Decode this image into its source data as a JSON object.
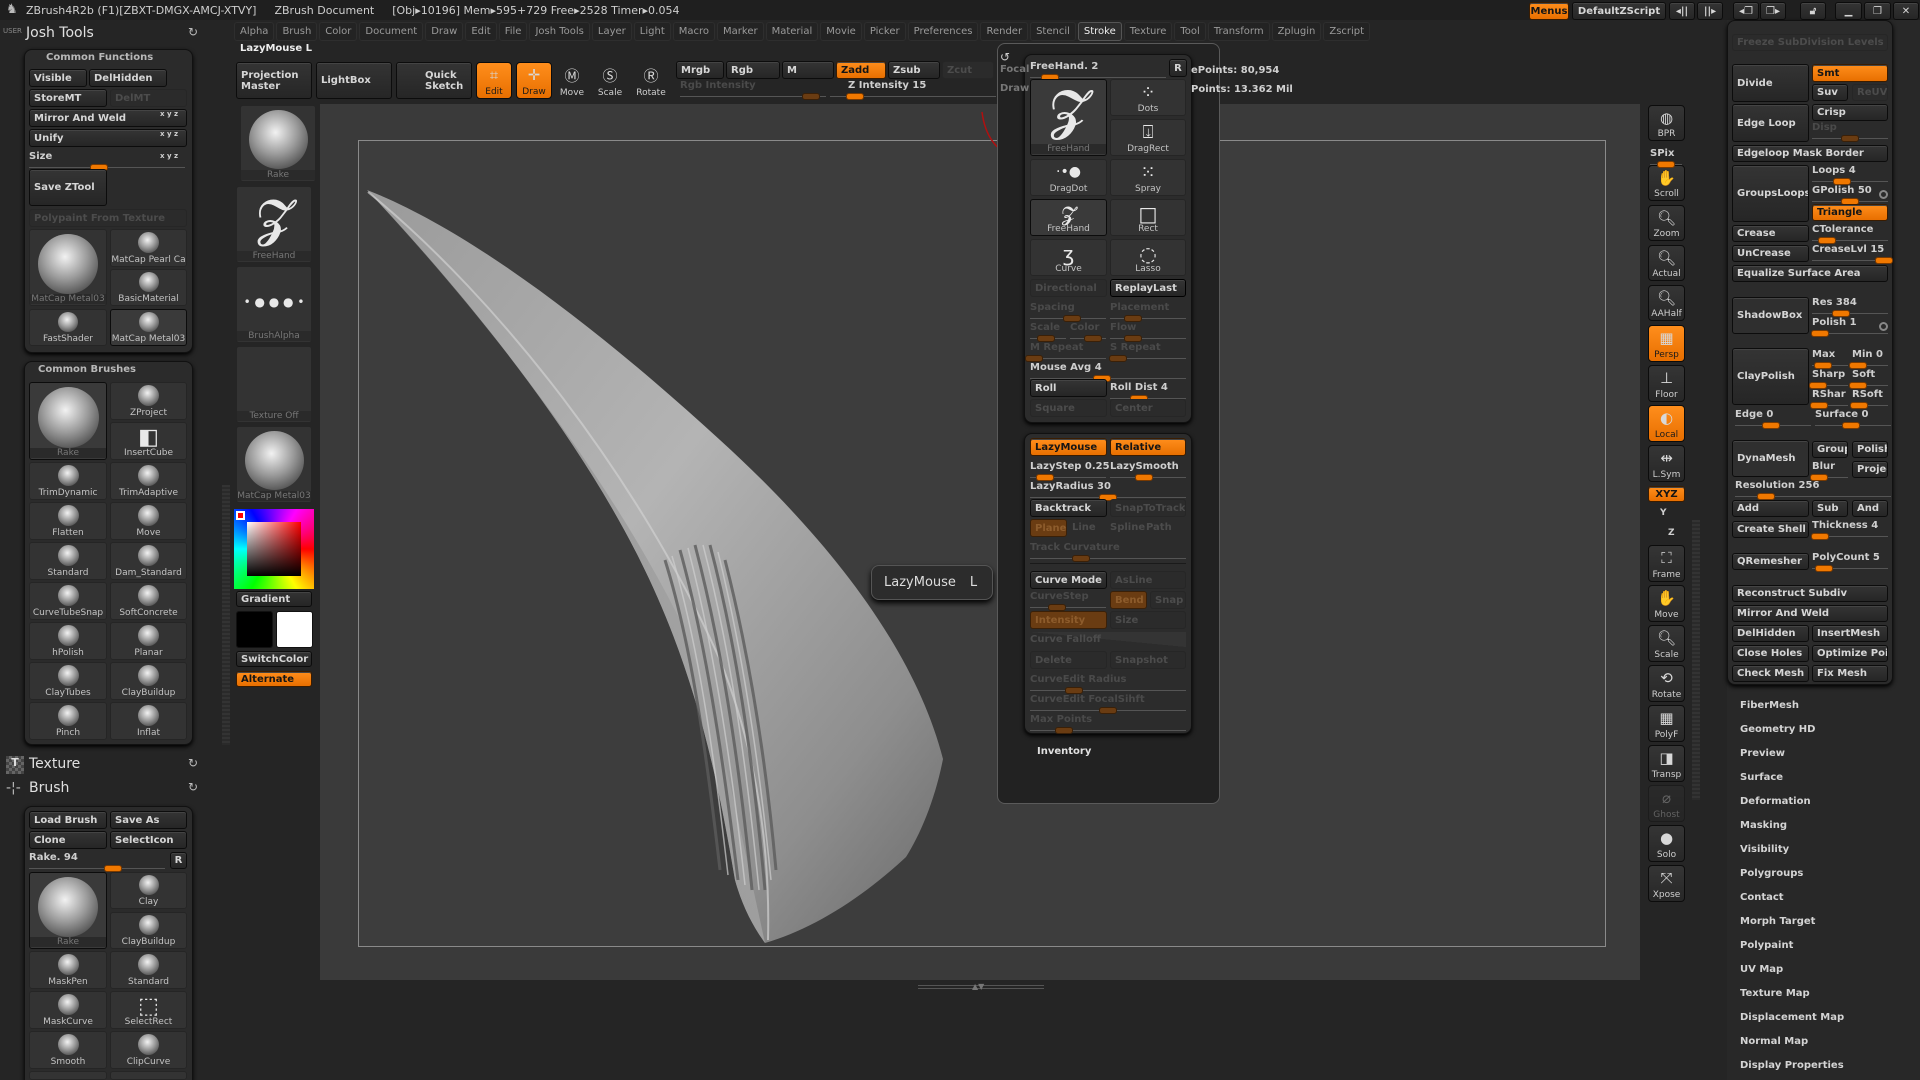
{
  "titlebar": {
    "app": "ZBrush4R2b (F1)[ZBXT-DMGX-AMCJ-XTVY]",
    "document": "ZBrush Document",
    "stats": "[Obj▸10196] Mem▸595+729 Free▸2528 Timer▸0.054"
  },
  "menus": [
    "Alpha",
    "Brush",
    "Color",
    "Document",
    "Draw",
    "Edit",
    "File",
    "Josh Tools",
    "Layer",
    "Light",
    "Macro",
    "Marker",
    "Material",
    "Movie",
    "Picker",
    "Preferences",
    "Render",
    "Stencil",
    "Stroke",
    "Texture",
    "Tool",
    "Transform",
    "Zplugin",
    "Zscript"
  ],
  "active_menu": "Stroke",
  "topright": {
    "menus": "Menus",
    "script": "DefaultZScript"
  },
  "left": {
    "user": "USER",
    "title": "Josh Tools",
    "cf": {
      "title": "Common Functions",
      "visible": "Visible",
      "delhidden": "DelHidden",
      "storemt": "StoreMT",
      "delmt": "DelMT",
      "mirror": "Mirror And Weld",
      "unify": "Unify",
      "xyz": "x y z",
      "size": {
        "label": "Size",
        "v": 0.45
      },
      "save": "Save ZTool",
      "polypaint": "Polypaint From Texture",
      "mats": [
        "MatCap Metal03",
        "MatCap Pearl Ca",
        "BasicMaterial",
        "FastShader",
        "MatCap Metal03"
      ]
    },
    "cb": {
      "title": "Common Brushes",
      "items": [
        "Rake",
        "ZProject",
        "InsertCube",
        "TrimDynamic",
        "TrimAdaptive",
        "Flatten",
        "Move",
        "Standard",
        "Dam_Standard",
        "CurveTubeSnap",
        "SoftConcrete",
        "hPolish",
        "Planar",
        "ClayTubes",
        "ClayBuildup",
        "Pinch",
        "Inflat"
      ]
    },
    "texture": "Texture",
    "brush": "Brush",
    "br": {
      "load": "Load Brush",
      "saveas": "Save As",
      "clone": "Clone",
      "selecticon": "SelectIcon",
      "slider": {
        "label": "Rake. 94",
        "v": 0.62
      },
      "r": "R",
      "items": [
        "Rake",
        "Clay",
        "ClayBuildup",
        "MaskPen",
        "Standard",
        "MaskCurve",
        "SelectRect",
        "Smooth",
        "ClipCurve"
      ]
    }
  },
  "shelf": {
    "lazylabel": "LazyMouse  L",
    "projection": "Projection Master",
    "lightbox": "LightBox",
    "quicksketch": "Quick Sketch",
    "edit": "Edit",
    "draw": "Draw",
    "move": "Move",
    "scale": "Scale",
    "rotate": "Rotate",
    "mrgb": "Mrgb",
    "rgb": "Rgb",
    "m": "M",
    "zadd": "Zadd",
    "zsub": "Zsub",
    "zcut": "Zcut",
    "rgb_int": {
      "label": "Rgb Intensity",
      "v": 0.9
    },
    "z_int": {
      "label": "Z Intensity 15",
      "v": 0.15
    },
    "focal": "Focal",
    "drawsize": "Draw",
    "active_points": "ePoints: 80,954",
    "total_points": "Points: 13.362 Mil"
  },
  "leftshelf": {
    "brush": "Rake",
    "stroke": "FreeHand",
    "alpha": "BrushAlpha",
    "texture": "Texture Off",
    "material": "MatCap Metal03",
    "gradient": "Gradient",
    "switch": "SwitchColor",
    "alternate": "Alternate",
    "colors": {
      "main": "#000000",
      "secondary": "#ffffff",
      "picked": "#ff0000"
    }
  },
  "stroke": {
    "freehand": {
      "label": "FreeHand. 2",
      "v": 0.15
    },
    "r": "R",
    "strokes": [
      "FreeHand",
      "Dots",
      "DragRect",
      "DragDot",
      "Spray",
      "FreeHand",
      "Rect",
      "Curve",
      "Lasso"
    ],
    "directional": "Directional",
    "replaylast": "ReplayLast",
    "spacing": {
      "label": "Spacing",
      "v": 0.55
    },
    "placement": {
      "label": "Placement",
      "v": 0.3
    },
    "scale": {
      "label": "Scale",
      "v": 0.45
    },
    "color": {
      "label": "Color",
      "v": 0.65
    },
    "flow": {
      "label": "Flow",
      "v": 0.3
    },
    "mrepeat": {
      "label": "M Repeat",
      "v": 0.05
    },
    "srepeat": {
      "label": "S Repeat",
      "v": 0.1
    },
    "mouseavg": {
      "label": "Mouse Avg 4",
      "v": 0.46
    },
    "roll": "Roll",
    "rolldist": {
      "label": "Roll Dist 4",
      "v": 0.38
    },
    "square": "Square",
    "center": "Center",
    "lazymouse": "LazyMouse",
    "relative": "Relative",
    "lazystep": {
      "label": "LazyStep 0.25",
      "v": 0.2
    },
    "lazysmooth": {
      "label": "LazySmooth",
      "v": 0.45
    },
    "lazyradius": {
      "label": "LazyRadius 30",
      "v": 0.5
    },
    "backtrack": "Backtrack",
    "snaptotrack": "SnapToTrack",
    "plane": "Plane",
    "line": "Line",
    "spline": "Spline",
    "path": "Path",
    "trackcurv": {
      "label": "Track Curvature",
      "v": 0.33
    },
    "curvemode": "Curve Mode",
    "asline": "AsLine",
    "curvestep": {
      "label": "CurveStep",
      "v": 0.35
    },
    "bend": "Bend",
    "snap": "Snap",
    "intensity": "Intensity",
    "size": "Size",
    "falloff": "Curve Falloff",
    "delete": "Delete",
    "snapshot": "Snapshot",
    "ceradius": {
      "label": "CurveEdit Radius",
      "v": 0.28
    },
    "cefocal": {
      "label": "CurveEdit FocalSihft",
      "v": 0.5
    },
    "maxpoints": {
      "label": "Max Points",
      "v": 0.22
    },
    "inventory": "Inventory"
  },
  "tooltip": {
    "name": "LazyMouse",
    "key": "L"
  },
  "rightshelf": [
    "BPR",
    "SPix",
    "Scroll",
    "Zoom",
    "Actual",
    "AAHalf",
    "Persp",
    "Floor",
    "Local",
    "L.Sym",
    "XYZ",
    "Y",
    "Z",
    "Frame",
    "Move",
    "Scale",
    "Rotate",
    "PolyF",
    "Transp",
    "Ghost",
    "Solo",
    "Xpose"
  ],
  "tool": {
    "freeze": "Freeze SubDivision Levels",
    "divide": "Divide",
    "smt": "Smt",
    "suv": "Suv",
    "reuv": "ReUV",
    "edgeloop": "Edge Loop",
    "crisp": "Crisp",
    "disp": {
      "label": "Disp",
      "v": 0.5
    },
    "emb": "Edgeloop Mask Border",
    "groupsloops": "GroupsLoops",
    "loops": {
      "label": "Loops 4",
      "v": 0.4
    },
    "gpolish": {
      "label": "GPolish 50",
      "v": 0.5
    },
    "triangle": "Triangle",
    "crease": "Crease",
    "ctol": {
      "label": "CTolerance",
      "v": 0.2
    },
    "uncrease": "UnCrease",
    "creaselvl": {
      "label": "CreaseLvl 15",
      "v": 0.95
    },
    "equalize": "Equalize Surface Area",
    "shadowbox": "ShadowBox",
    "res": {
      "label": "Res 384",
      "v": 0.38
    },
    "polish": {
      "label": "Polish 1",
      "v": 0.1
    },
    "claypolish": "ClayPolish",
    "max": {
      "label": "Max",
      "v": 0.3
    },
    "min": {
      "label": "Min 0",
      "v": 0.18
    },
    "sharp": {
      "label": "Sharp",
      "v": 0.18
    },
    "soft": {
      "label": "Soft",
      "v": 0.18
    },
    "rshar": {
      "label": "RShar",
      "v": 0.2
    },
    "rsoft": {
      "label": "RSoft",
      "v": 0.2
    },
    "edge": {
      "label": "Edge 0",
      "v": 0.48
    },
    "surface": {
      "label": "Surface 0",
      "v": 0.48
    },
    "dynamesh": "DynaMesh",
    "group": "Group",
    "dpolish": "Polish",
    "blur": {
      "label": "Blur",
      "v": 0.2
    },
    "projec": "Projec",
    "resolution": {
      "label": "Resolution 256",
      "v": 0.2
    },
    "add": "Add",
    "sub": "Sub",
    "and": "And",
    "shell": "Create Shell",
    "thickness": {
      "label": "Thickness 4",
      "v": 0.1
    },
    "qremesher": "QRemesher",
    "polycount": {
      "label": "PolyCount 5",
      "v": 0.16
    },
    "recon": "Reconstruct Subdiv",
    "mirror": "Mirror And Weld",
    "delhidden": "DelHidden",
    "insertmesh": "InsertMesh",
    "closeholes": "Close Holes",
    "optimize": "Optimize Poi",
    "checkmesh": "Check Mesh",
    "fixmesh": "Fix Mesh",
    "subpalettes": [
      "FiberMesh",
      "Geometry HD",
      "Preview",
      "Surface",
      "Deformation",
      "Masking",
      "Visibility",
      "Polygroups",
      "Contact",
      "Morph Target",
      "Polypaint",
      "UV Map",
      "Texture Map",
      "Displacement Map",
      "Normal Map",
      "Display Properties"
    ]
  }
}
